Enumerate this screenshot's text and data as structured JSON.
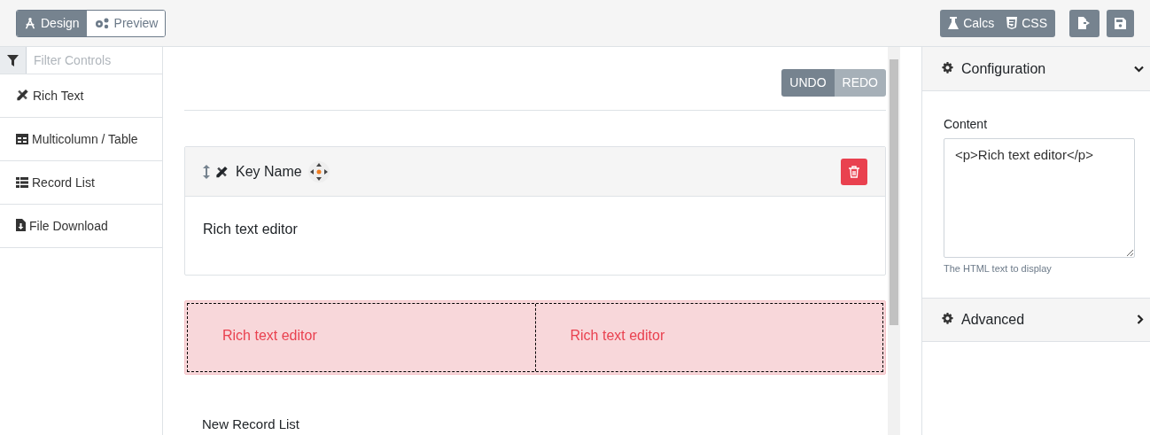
{
  "mode_toggle": [
    {
      "label": "Design",
      "kind": "design",
      "selected": true
    },
    {
      "label": "Preview",
      "kind": "preview",
      "selected": false
    }
  ],
  "toolbar": {
    "buttons": [
      {
        "label": "Calcs",
        "kind": "flask"
      },
      {
        "label": "CSS",
        "kind": "css"
      }
    ]
  },
  "sidebar": {
    "filter": {
      "placeholder": "Filter Controls"
    },
    "items": [
      {
        "label": "Rich Text",
        "kind": "rich_text"
      },
      {
        "label": "Multicolumn / Table",
        "kind": "table"
      },
      {
        "label": "Record List",
        "kind": "list"
      },
      {
        "label": "File Download",
        "kind": "file"
      }
    ]
  },
  "canvas": {
    "history": [
      {
        "label": "UNDO",
        "disabled": false
      },
      {
        "label": "REDO",
        "disabled": true
      }
    ],
    "card": {
      "title": "Key Name",
      "body": "Rich text editor"
    },
    "columns_block": {
      "highlighted": true,
      "cells": [
        "Rich text editor",
        "Rich text editor"
      ]
    },
    "next_item": "New Record List"
  },
  "config_panel": {
    "sections": [
      {
        "title": "Configuration",
        "expanded": true,
        "field": {
          "label": "Content",
          "value": "<p>Rich text editor</p>",
          "help": "The HTML text to display"
        }
      },
      {
        "title": "Advanced",
        "expanded": false
      }
    ]
  }
}
